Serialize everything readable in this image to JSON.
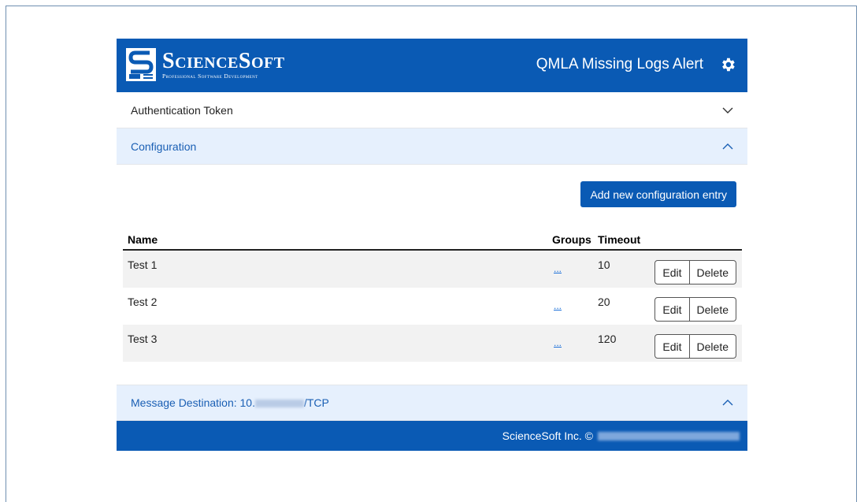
{
  "header": {
    "logo_name": "ScienceSoft",
    "logo_tagline": "Professional Software Development",
    "app_title": "QMLA Missing Logs Alert",
    "gear_icon": "gear-icon",
    "brand_color": "#0a5ab4"
  },
  "sections": {
    "auth_token": "Authentication Token",
    "configuration": "Configuration",
    "message_destination_prefix": "Message Destination: 10.",
    "message_destination_suffix": "/TCP"
  },
  "configuration": {
    "add_button": "Add new configuration entry",
    "columns": {
      "name": "Name",
      "groups": "Groups",
      "timeout": "Timeout"
    },
    "rows": [
      {
        "name": "Test 1",
        "groups": "...",
        "timeout": "10",
        "edit": "Edit",
        "delete": "Delete"
      },
      {
        "name": "Test 2",
        "groups": "...",
        "timeout": "20",
        "edit": "Edit",
        "delete": "Delete"
      },
      {
        "name": "Test 3",
        "groups": "...",
        "timeout": "120",
        "edit": "Edit",
        "delete": "Delete"
      }
    ]
  },
  "footer": {
    "copyright": "ScienceSoft Inc. ©"
  }
}
